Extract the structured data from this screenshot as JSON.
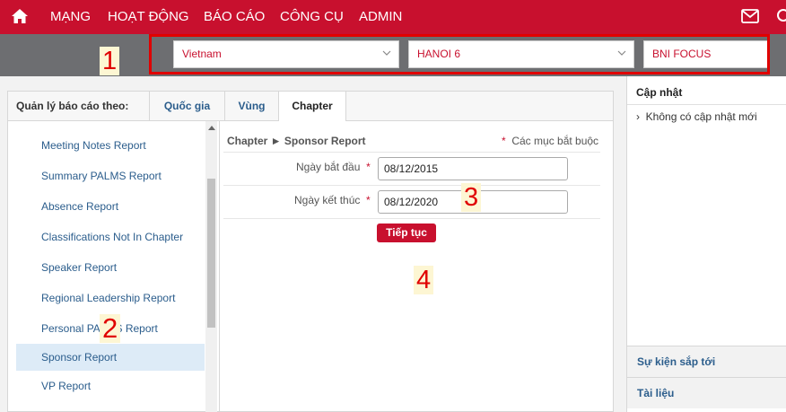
{
  "topnav": {
    "items": [
      "MẠNG",
      "HOẠT ĐỘNG",
      "BÁO CÁO",
      "CÔNG CỤ",
      "ADMIN"
    ]
  },
  "filters": {
    "country": "Vietnam",
    "region": "HANOI 6",
    "chapter": "BNI FOCUS"
  },
  "markers": [
    "1",
    "2",
    "3",
    "4"
  ],
  "tabs": {
    "label": "Quản lý báo cáo theo:",
    "items": [
      "Quốc gia",
      "Vùng",
      "Chapter"
    ],
    "active": "Chapter"
  },
  "reports": [
    "Meeting Notes Report",
    "Summary PALMS Report",
    "Absence Report",
    "Classifications Not In Chapter",
    "Speaker Report",
    "Regional Leadership Report",
    "Personal PALMS Report",
    "Sponsor Report",
    "VP Report"
  ],
  "form": {
    "breadcrumb": "Chapter ► Sponsor Report",
    "required_star": "*",
    "required_note": "Các mục bắt buộc",
    "start_label": "Ngày bắt đầu",
    "start_value": "08/12/2015",
    "end_label": "Ngày kết thúc",
    "end_value": "08/12/2020",
    "submit": "Tiếp tục"
  },
  "right": {
    "updates_title": "Cập nhật",
    "updates_item": "Không có cập nhật mới",
    "upcoming": "Sự kiện sắp tới",
    "documents": "Tài liệu"
  },
  "colors": {
    "brand": "#c8102e",
    "link": "#2b5d8c",
    "selected_row": "#ddebf7"
  }
}
